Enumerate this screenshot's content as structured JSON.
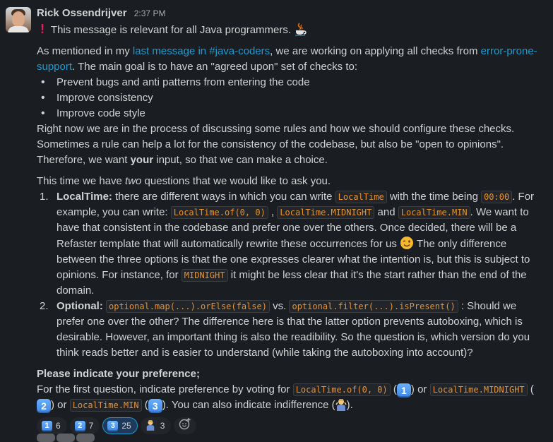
{
  "author": "Rick Ossendrijver",
  "timestamp": "2:37 PM",
  "intro": "This message is relevant for all Java programmers.",
  "para1": {
    "pre": "As mentioned in my ",
    "link1": "last message in #java-coders",
    "mid": ", we are working on applying all checks from ",
    "link2": "error-prone-support",
    "post": ". The main goal is to have an \"agreed upon\" set of checks to:"
  },
  "bullets": [
    "Prevent bugs and anti patterns from entering the code",
    "Improve consistency",
    "Improve code style"
  ],
  "para2": {
    "line1": "Right now we are in the process of discussing some rules and how we should configure these checks.",
    "line2": "Sometimes a rule can help a lot for the consistency of the codebase, but also be \"open to opinions\".",
    "line3_pre": "Therefore, we want ",
    "line3_bold": "your",
    "line3_post": " input, so that we can make a choice."
  },
  "para3": {
    "pre": "This time we have ",
    "italic": "two",
    "post": " questions that we would like to ask you."
  },
  "q1": {
    "num": "1.",
    "title": "LocalTime:",
    "t1": " there are different ways in which you can write ",
    "c1": "LocalTime",
    "t2": " with the time being ",
    "c2": "00:00",
    "t3": ". For example, you can write: ",
    "c3": "LocalTime.of(0, 0)",
    "t4": " , ",
    "c4": "LocalTime.MIDNIGHT",
    "t5": " and ",
    "c5": "LocalTime.MIN",
    "t6": ". We want to have that consistent in the codebase and prefer one over the others. Once decided, there will be a Refaster template that will automatically rewrite these occurrences for us ",
    "t7": "  The only difference between the three options is that the one expresses clearer what the intention is, but this is subject to opinions. For instance, for ",
    "c6": "MIDNIGHT",
    "t8": " it might be less clear that it's the start rather than the end of the domain."
  },
  "q2": {
    "num": "2.",
    "title": "Optional:",
    "c1": "optional.map(...).orElse(false)",
    "t1": " vs. ",
    "c2": "optional.filter(...).isPresent()",
    "t2": " :  Should we prefer one over the other? The difference here is that the latter option prevents autoboxing, which is desirable. However, an important thing is also the readibility. So the question is, which version do you think reads better and is easier to understand (while taking the autoboxing into account)?"
  },
  "pref": {
    "heading": "Please indicate your preference;",
    "t1": "For the first question, indicate preference by voting for ",
    "c1": "LocalTime.of(0, 0)",
    "k1": "1",
    "t2": " or ",
    "c2": "LocalTime.MIDNIGHT",
    "k2": "2",
    "t3": " or ",
    "c3": "LocalTime.MIN",
    "k3": "3",
    "t4": ". You can also indicate indifference (",
    "t5": ")."
  },
  "reactions": [
    {
      "key": "1",
      "count": "6",
      "active": false
    },
    {
      "key": "2",
      "count": "7",
      "active": false
    },
    {
      "key": "3",
      "count": "25",
      "active": true
    },
    {
      "emoji": "shrug",
      "count": "3",
      "active": false
    }
  ],
  "colors": {
    "background": "#1a1d21",
    "text": "#d1d2d3",
    "link": "#1d9bd1",
    "code": "#e8912d",
    "exclamation": "#e01e5a",
    "keycap": "#4a90e2"
  }
}
